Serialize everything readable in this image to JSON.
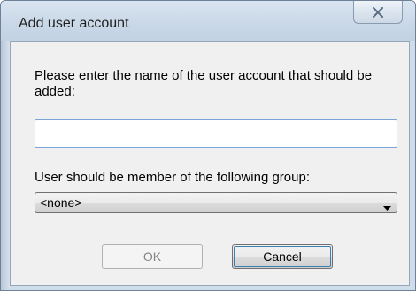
{
  "window": {
    "title": "Add user account"
  },
  "form": {
    "prompt": "Please enter the name of the user account that should be added:",
    "name_value": "",
    "group_label": "User should be member of the following group:",
    "group_selected": "<none>"
  },
  "buttons": {
    "ok_label": "OK",
    "ok_enabled": false,
    "cancel_label": "Cancel"
  },
  "colors": {
    "title_bar": "#cbd9e8",
    "client_bg": "#f0f0f0",
    "input_focus_border": "#7aa5d6",
    "default_button_border": "#3c7fb1"
  },
  "icons": {
    "close": "close-icon",
    "dropdown": "chevron-down-icon"
  }
}
